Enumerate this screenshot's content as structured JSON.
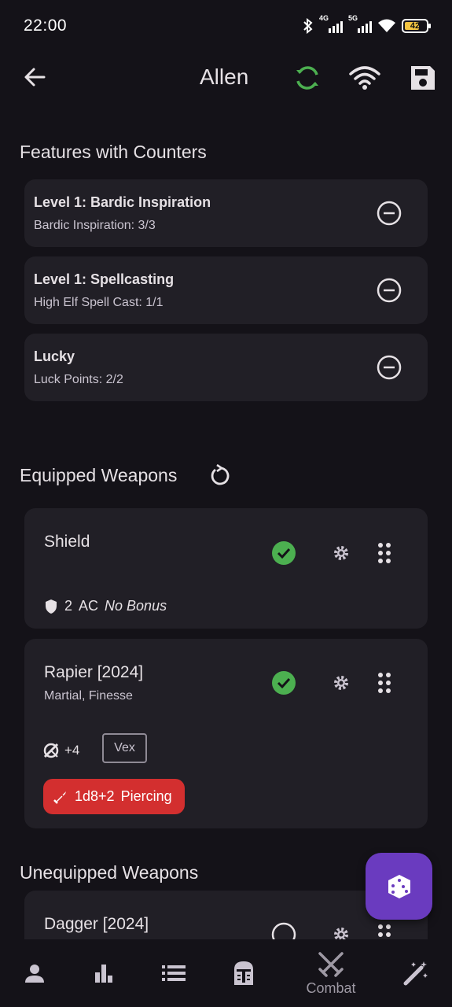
{
  "status_bar": {
    "time": "22:00",
    "net1": "4G",
    "net2": "5G",
    "battery": "42"
  },
  "app_bar": {
    "title": "Allen",
    "icons": [
      "back-arrow-icon",
      "sync-icon",
      "wifi-icon",
      "save-icon"
    ],
    "sync_color": "#4caf50"
  },
  "features": {
    "title": "Features with Counters",
    "items": [
      {
        "name": "Level 1: Bardic Inspiration",
        "sub": "Bardic Inspiration: 3/3"
      },
      {
        "name": "Level 1: Spellcasting",
        "sub": "High Elf Spell Cast: 1/1"
      },
      {
        "name": "Lucky",
        "sub": "Luck Points: 2/2"
      }
    ]
  },
  "equipped": {
    "title": "Equipped Weapons",
    "shield": {
      "name": "Shield",
      "ac_value": "2",
      "ac_label": "AC",
      "ac_bonus": "No Bonus"
    },
    "rapier": {
      "name": "Rapier [2024]",
      "props": "Martial, Finesse",
      "hit": "+4",
      "mastery": "Vex",
      "damage": "1d8+2",
      "damage_type": "Piercing"
    }
  },
  "unequipped": {
    "title": "Unequipped Weapons",
    "items": [
      {
        "name": "Dagger [2024]"
      }
    ]
  },
  "bottom_nav": {
    "items": [
      {
        "icon": "person-icon"
      },
      {
        "icon": "bar-chart-icon"
      },
      {
        "icon": "list-icon"
      },
      {
        "icon": "helmet-icon"
      },
      {
        "icon": "crossed-swords-icon",
        "label": "Combat"
      },
      {
        "icon": "magic-wand-icon"
      }
    ]
  },
  "colors": {
    "background": "#141218",
    "card": "#211f26",
    "check_green": "#4caf50",
    "damage_red": "#d32f2f",
    "fab_purple": "#6a3bbf"
  }
}
